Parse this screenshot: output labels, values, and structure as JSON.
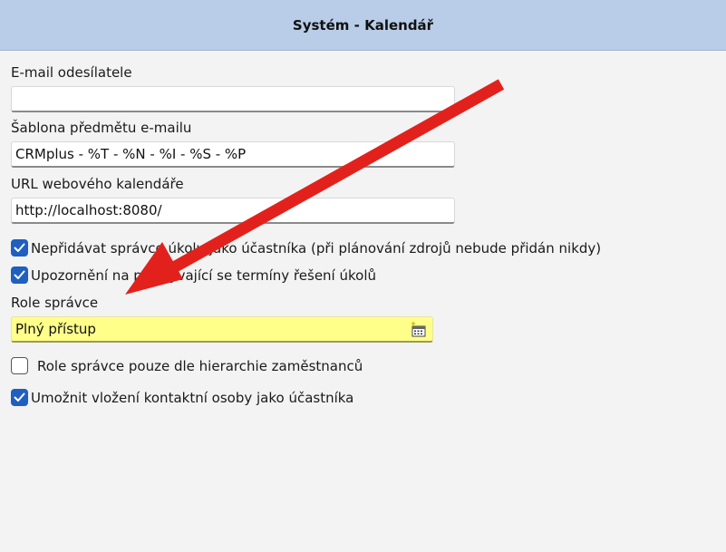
{
  "window": {
    "title": "Systém - Kalendář"
  },
  "form": {
    "sender_email": {
      "label": "E-mail odesílatele",
      "value": ""
    },
    "subject_template": {
      "label": "Šablona předmětu e-mailu",
      "value": "CRMplus - %T - %N - %I - %S - %P"
    },
    "calendar_url": {
      "label": "URL webového kalendáře",
      "value": "http://localhost:8080/"
    },
    "options": [
      {
        "label": "Nepřidávat správce úkolu jako účastníka (při plánování zdrojů nebude přidán nikdy)",
        "checked": true
      },
      {
        "label": "Upozornění na překrývající se termíny řešení úkolů",
        "checked": true
      }
    ],
    "manager_role": {
      "label": "Role správce",
      "value": "Plný přístup",
      "icon": "calendar-list-icon"
    },
    "hierarchy_option": {
      "label": "Role správce pouze dle hierarchie zaměstnanců",
      "checked": false
    },
    "contact_option": {
      "label": "Umožnit vložení kontaktní osoby jako účastníka",
      "checked": true
    }
  },
  "annotation": {
    "type": "arrow",
    "color": "#e3211c"
  },
  "colors": {
    "title_bar": "#b9cde8",
    "checkbox_on": "#1f5fbf",
    "highlight_field": "#ffff8a"
  }
}
